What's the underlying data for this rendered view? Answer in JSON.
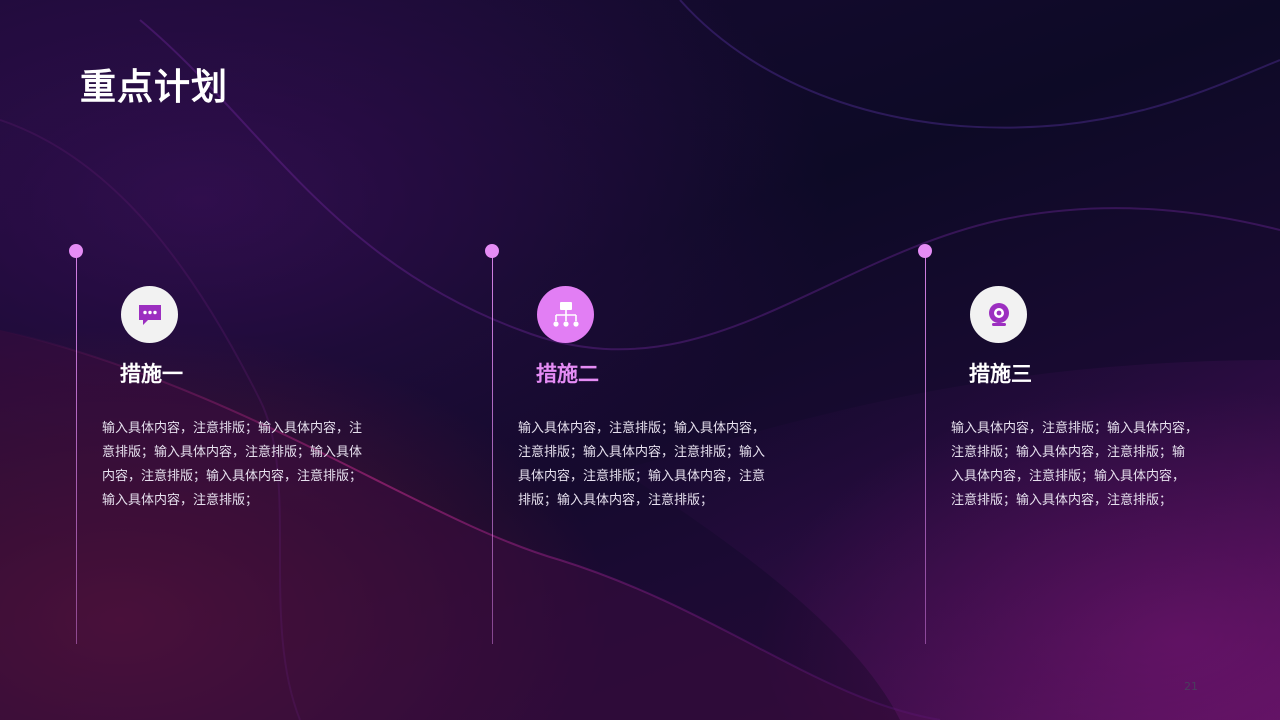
{
  "title": "重点计划",
  "colors": {
    "accent": "#e58cf5",
    "icon_purple": "#9c2fc0",
    "icon_light_bg": "#f2f2f2",
    "icon_accent_bg": "#e27ef4"
  },
  "items": [
    {
      "icon": "chat-bubble-icon",
      "heading": "措施一",
      "lines": [
        "输入具体内容，注意排版；输入具体内容，注",
        "意排版；输入具体内容，注意排版；输入具体",
        "内容，注意排版；输入具体内容，注意排版；",
        "输入具体内容，注意排版；"
      ]
    },
    {
      "icon": "hierarchy-icon",
      "heading": "措施二",
      "lines": [
        "输入具体内容，注意排版；输入具体内容，",
        "注意排版；输入具体内容，注意排版；输入",
        "具体内容，注意排版；输入具体内容，注意",
        "排版；输入具体内容，注意排版；"
      ]
    },
    {
      "icon": "webcam-icon",
      "heading": "措施三",
      "lines": [
        "输入具体内容，注意排版；输入具体内容，",
        "注意排版；输入具体内容，注意排版；输",
        "入具体内容，注意排版；输入具体内容，",
        "注意排版；输入具体内容，注意排版；"
      ]
    }
  ],
  "page_number": "21"
}
